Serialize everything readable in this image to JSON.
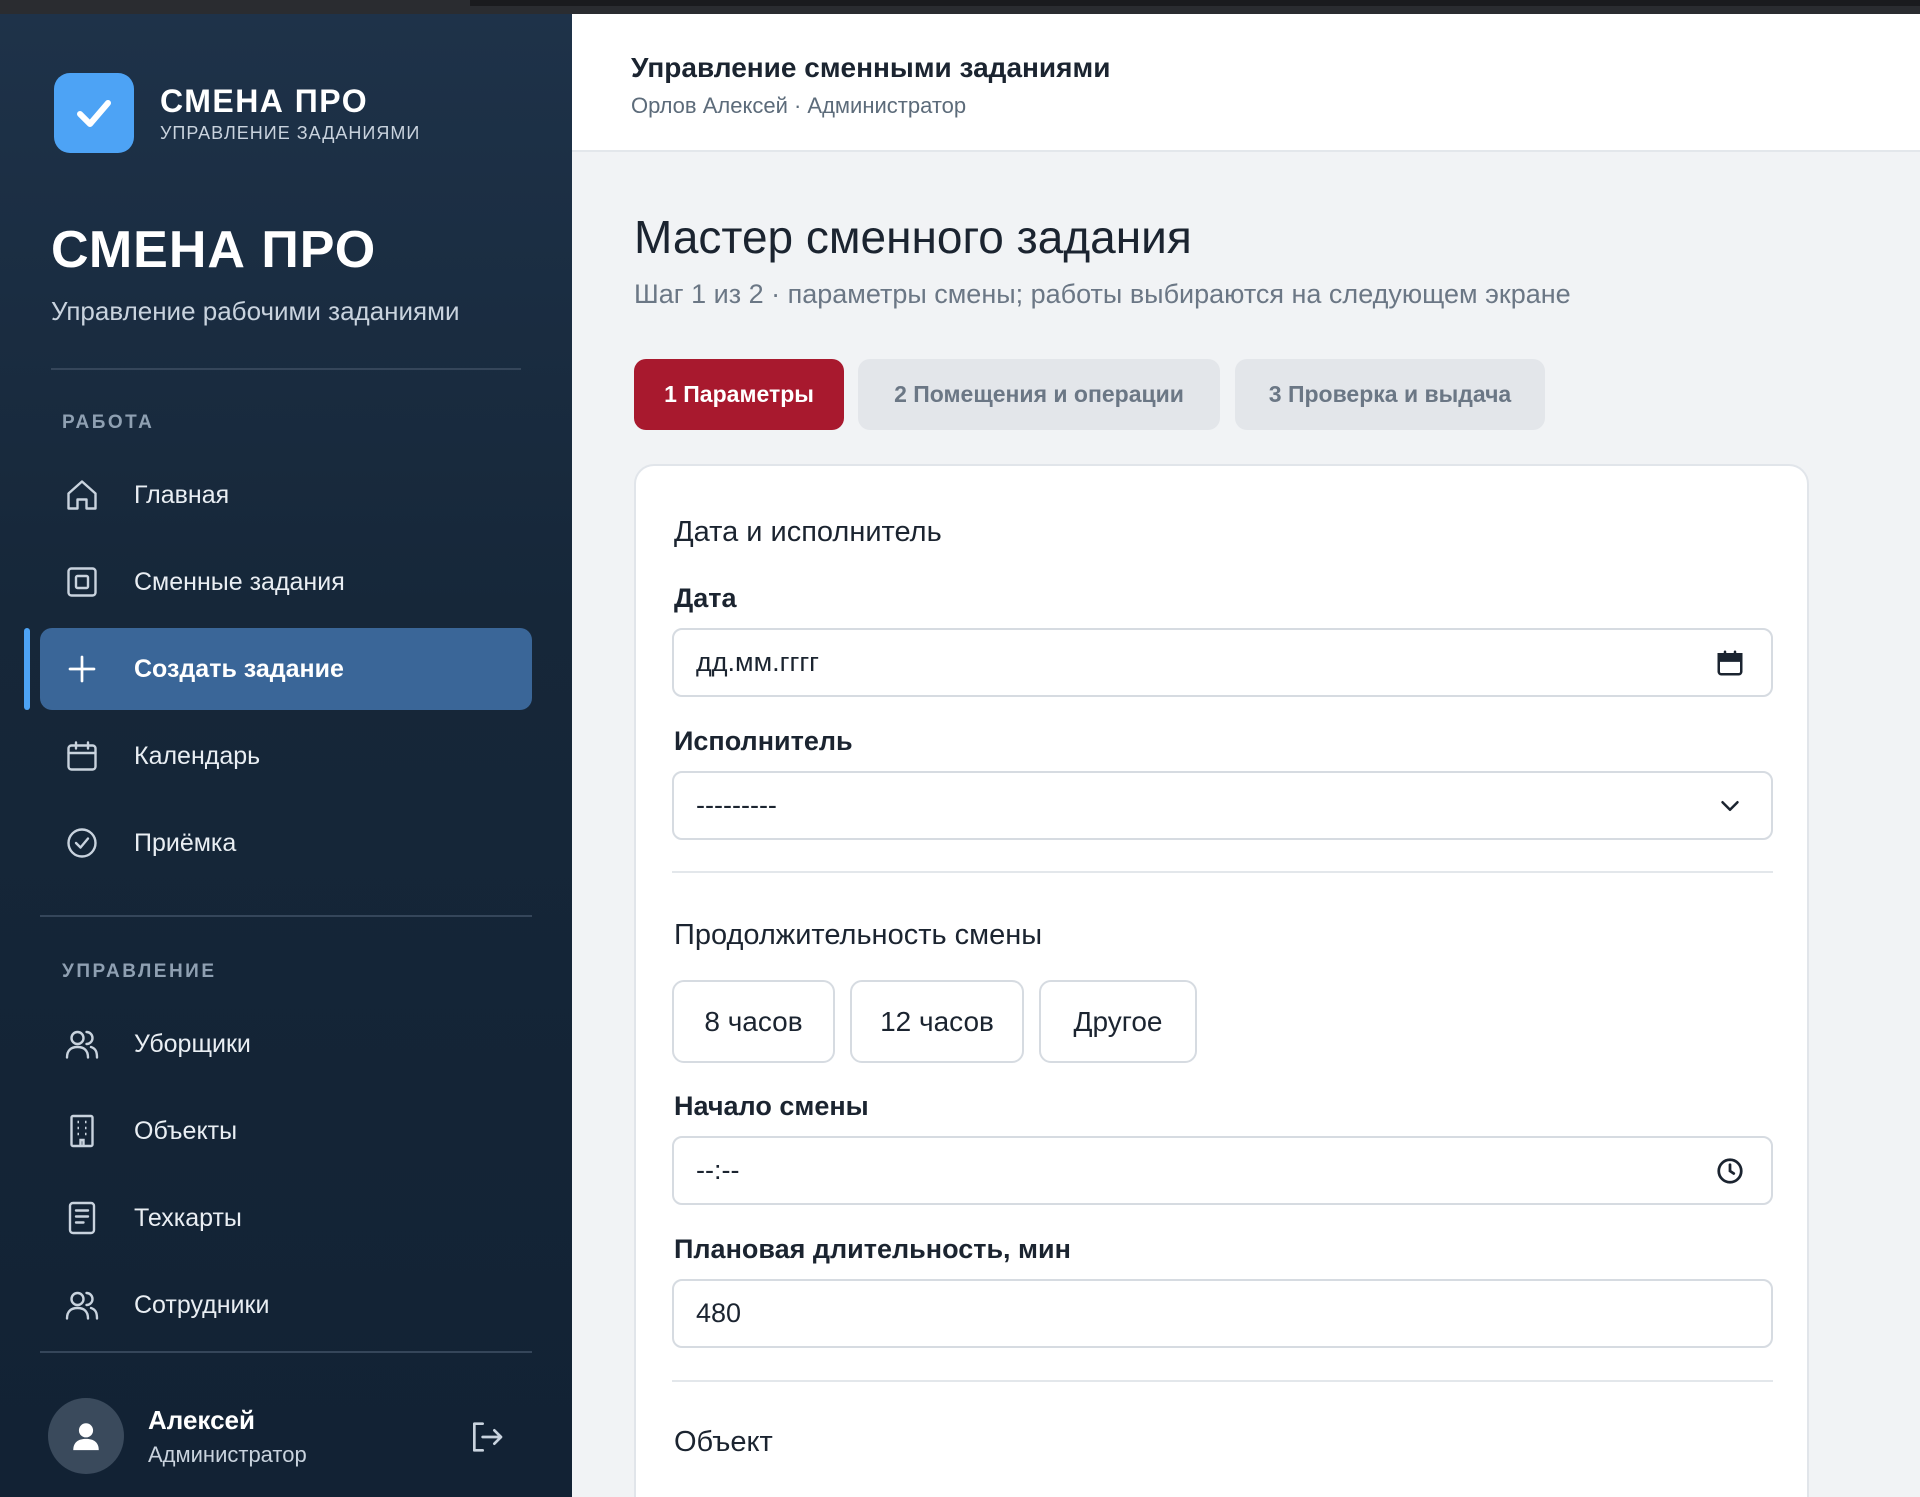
{
  "brand": {
    "name": "СМЕНА ПРО",
    "tagline": "УПРАВЛЕНИЕ ЗАДАНИЯМИ",
    "logo_color": "#4da3f5"
  },
  "sidebar": {
    "title": "СМЕНА ПРО",
    "subtitle": "Управление рабочими заданиями",
    "sections": [
      {
        "label": "РАБОТА",
        "items": [
          {
            "label": "Главная",
            "icon": "home-icon",
            "active": false
          },
          {
            "label": "Сменные задания",
            "icon": "tasks-icon",
            "active": false
          },
          {
            "label": "Создать задание",
            "icon": "plus-icon",
            "active": true
          },
          {
            "label": "Календарь",
            "icon": "calendar-icon",
            "active": false
          },
          {
            "label": "Приёмка",
            "icon": "check-circle-icon",
            "active": false
          }
        ]
      },
      {
        "label": "УПРАВЛЕНИЕ",
        "items": [
          {
            "label": "Уборщики",
            "icon": "users-icon",
            "active": false
          },
          {
            "label": "Объекты",
            "icon": "building-icon",
            "active": false
          },
          {
            "label": "Техкарты",
            "icon": "document-icon",
            "active": false
          },
          {
            "label": "Сотрудники",
            "icon": "users-icon",
            "active": false
          }
        ]
      }
    ],
    "user": {
      "name": "Алексей",
      "role": "Администратор"
    }
  },
  "header": {
    "title": "Управление сменными заданиями",
    "subtitle": "Орлов Алексей · Администратор"
  },
  "page": {
    "title": "Мастер сменного задания",
    "subtitle": "Шаг 1 из 2 · параметры смены; работы выбираются на следующем экране",
    "steps": [
      {
        "label": "1 Параметры",
        "active": true
      },
      {
        "label": "2 Помещения и операции",
        "active": false
      },
      {
        "label": "3 Проверка и выдача",
        "active": false
      }
    ],
    "accent_color": "#a8192e"
  },
  "form": {
    "section_date": "Дата и исполнитель",
    "date_label": "Дата",
    "date_value": "дд.мм.гггг",
    "executor_label": "Исполнитель",
    "executor_value": "---------",
    "section_duration": "Продолжительность смены",
    "duration_options": [
      "8 часов",
      "12 часов",
      "Другое"
    ],
    "start_label": "Начало смены",
    "start_value": "--:--",
    "planned_label": "Плановая длительность, мин",
    "planned_value": "480",
    "section_object": "Объект"
  }
}
